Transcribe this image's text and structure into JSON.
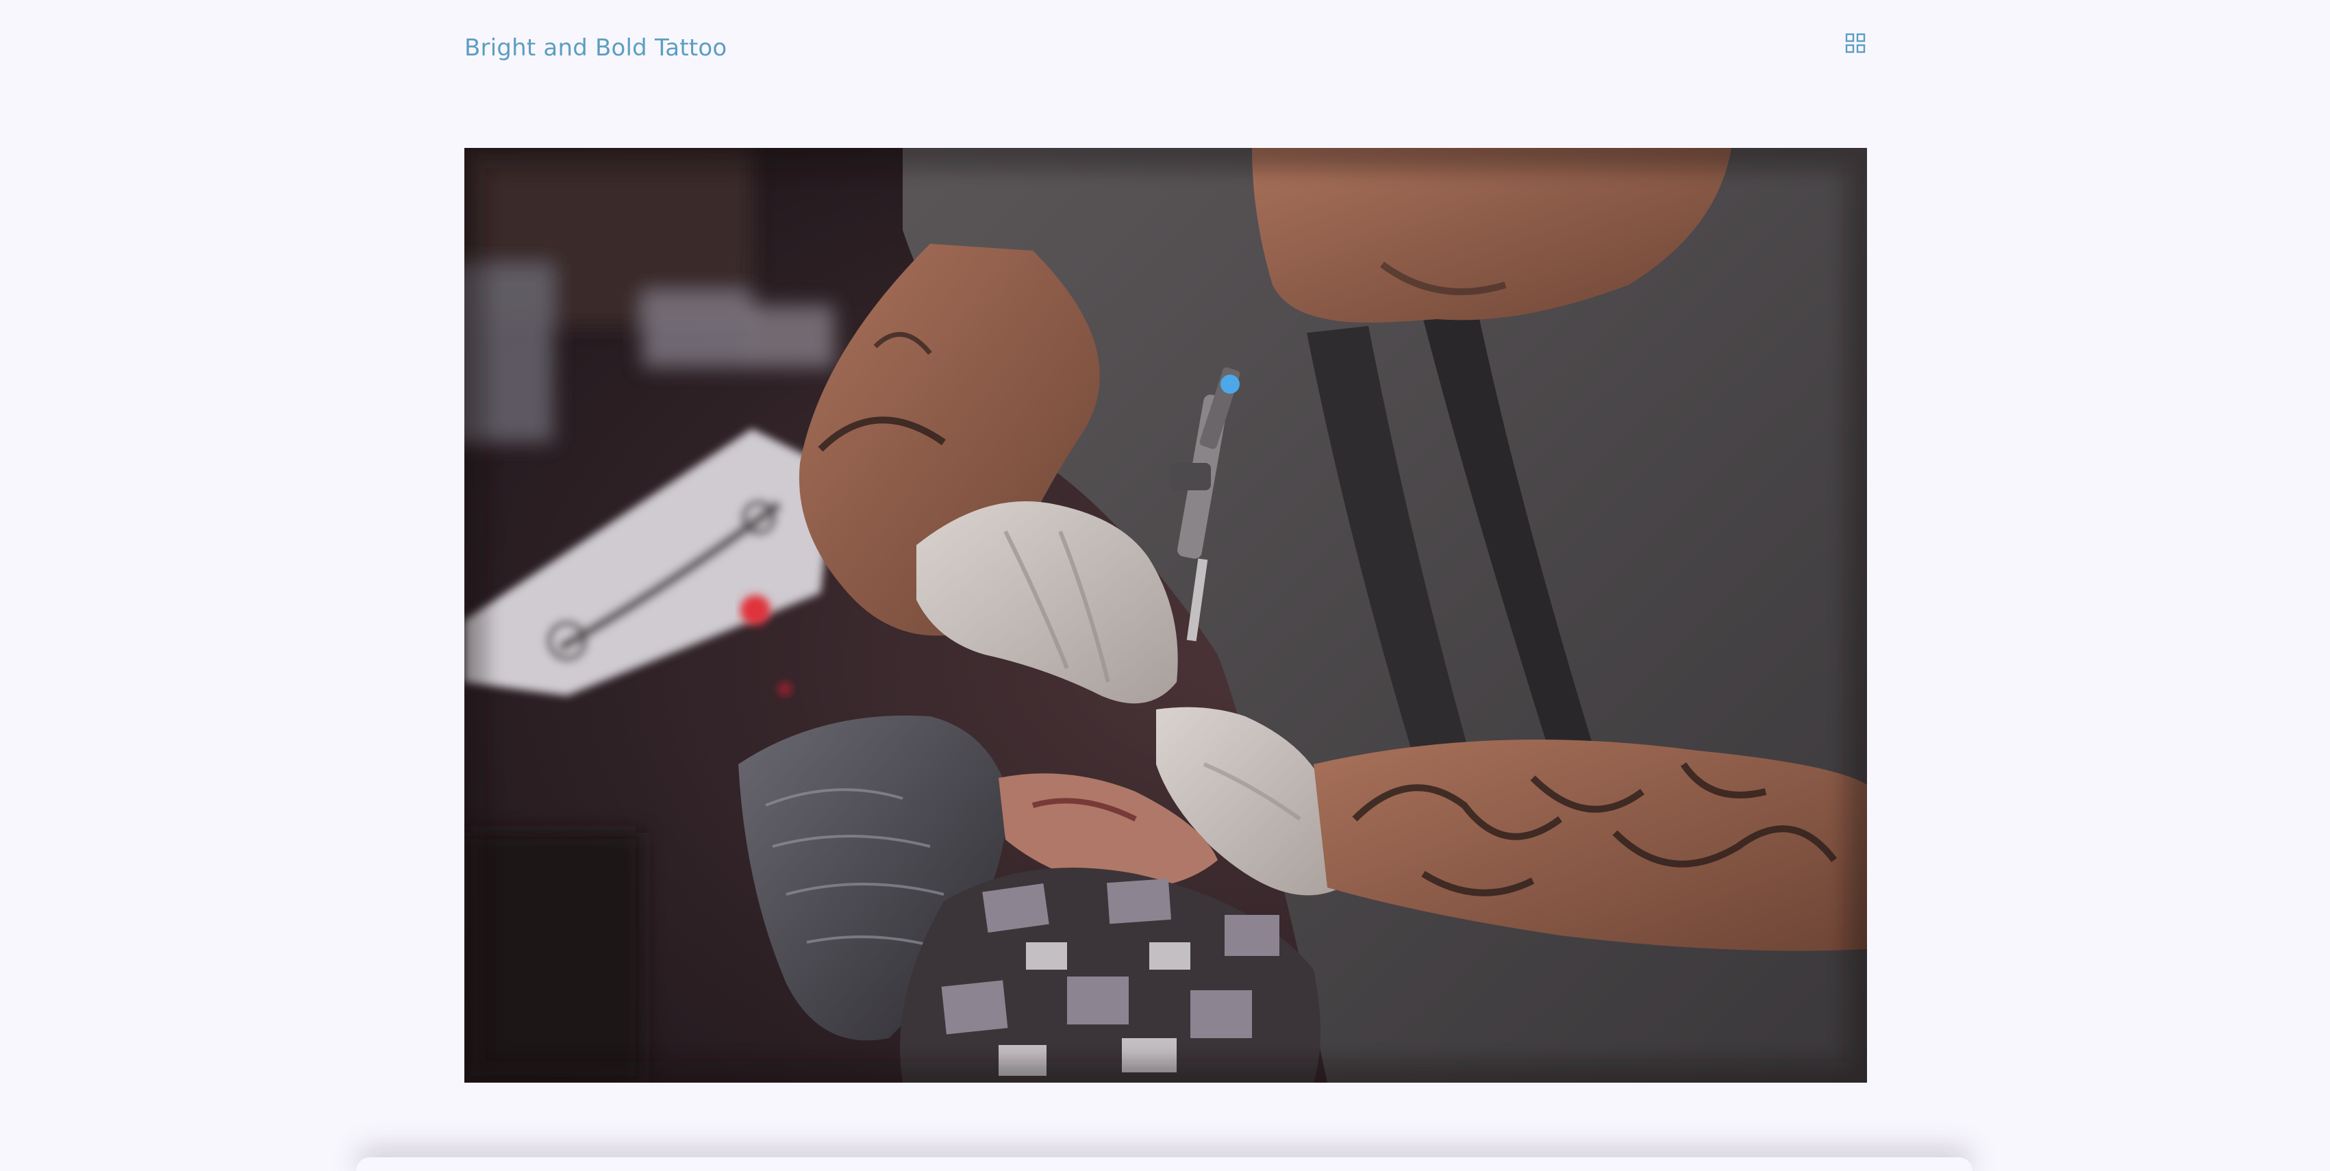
{
  "header": {
    "site_title": "Bright and Bold Tattoo",
    "menu_icon": "grid-menu-icon"
  },
  "colors": {
    "background": "#f9f7fe",
    "accent": "#5b9fc0"
  },
  "hero": {
    "image_subject": "tattoo-artist-photo"
  }
}
